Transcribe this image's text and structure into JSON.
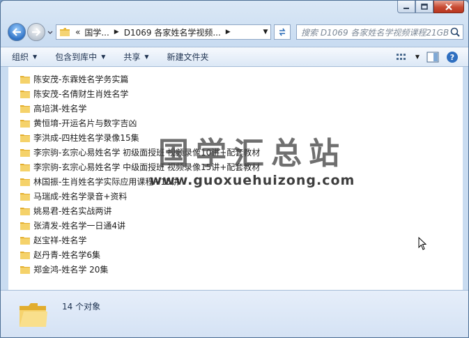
{
  "address": {
    "crumbs": [
      "«",
      "国学...",
      "D1069 各家姓名学视频..."
    ],
    "search_placeholder": "搜索 D1069 各家姓名学视频课程21GB"
  },
  "toolbar": {
    "organize": "组织",
    "include_library": "包含到库中",
    "share": "共享",
    "new_folder": "新建文件夹"
  },
  "files": [
    "陈安茂-东霖姓名学务实篇",
    "陈安茂-名倩财生肖姓名学",
    "高培淇-姓名学",
    "黄恒堉-开运名片与数字吉凶",
    "李洪成-四柱姓名学录像15集",
    "李宗驹-玄宗心易姓名学 初级面授班 视频录像10讲+配套教材",
    "李宗驹-玄宗心易姓名学 中级面授班 视频录像15讲+配套教材",
    "林国振-生肖姓名学实际应用课程+15讲",
    "马瑞成-姓名学录音+资料",
    "姚易君-姓名实战两讲",
    "张清发-姓名学一日通4讲",
    "赵宝祥-姓名学",
    "赵丹青-姓名学6集",
    "郑金鸿-姓名学 20集"
  ],
  "watermark": {
    "text": "国学汇总站",
    "url": "www.guoxuehuizong.com"
  },
  "status": {
    "count_text": "14 个对象"
  },
  "colors": {
    "folder": "#f0c94e",
    "frame": "#c9dcf1"
  }
}
